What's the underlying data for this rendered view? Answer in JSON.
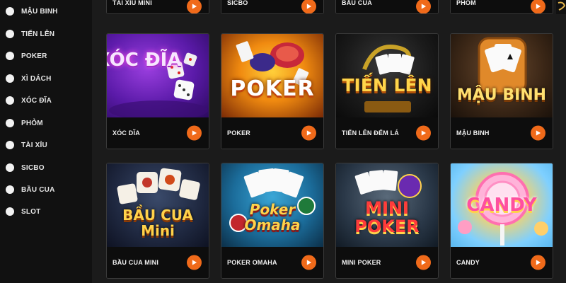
{
  "sidebar": {
    "items": [
      {
        "label": "MẬU BINH"
      },
      {
        "label": "TIẾN LÊN"
      },
      {
        "label": "POKER"
      },
      {
        "label": "XÌ DÁCH"
      },
      {
        "label": "XÓC ĐĨA"
      },
      {
        "label": "PHỎM"
      },
      {
        "label": "TÀI XỈU"
      },
      {
        "label": "SICBO"
      },
      {
        "label": "BẦU CUA"
      },
      {
        "label": "SLOT"
      }
    ]
  },
  "top_row": [
    {
      "name": "TÀI XỈU MINI"
    },
    {
      "name": "SICBO"
    },
    {
      "name": "BẦU CUA"
    },
    {
      "name": "PHỎM"
    }
  ],
  "games": [
    {
      "name": "XÓC DĨA",
      "art": "XÓC ĐĨA"
    },
    {
      "name": "POKER",
      "art": "POKER"
    },
    {
      "name": "TIẾN LÊN ĐẾM LÁ",
      "art": "TIẾN LÊN"
    },
    {
      "name": "MẬU BINH",
      "art": "MẬU BINH"
    },
    {
      "name": "BẦU CUA MINI",
      "art": "BẦU CUA Mini"
    },
    {
      "name": "POKER OMAHA",
      "art": "Poker Omaha"
    },
    {
      "name": "MINI POKER",
      "art": "MINI POKER"
    },
    {
      "name": "CANDY",
      "art": "CANDY"
    }
  ],
  "colors": {
    "accent": "#f06a1a",
    "sidebar_bg": "#111111",
    "card_bg": "#0d0d0d"
  },
  "icons": {
    "play": "play-triangle-icon",
    "radio": "radio-dot-icon"
  }
}
